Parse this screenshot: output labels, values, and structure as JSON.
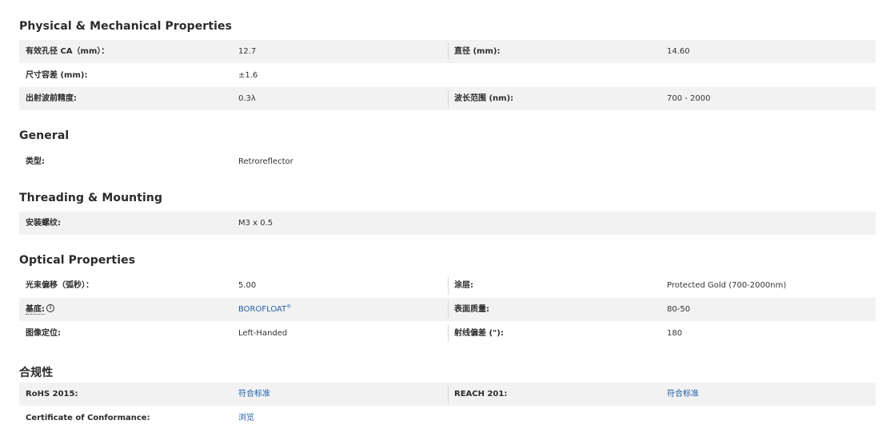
{
  "sections": {
    "physical": {
      "title": "Physical & Mechanical Properties",
      "rows": [
        {
          "l1": "有效孔径 CA（mm）：",
          "v1": "12.7",
          "l2": "直径 (mm):",
          "v2": "14.60"
        },
        {
          "l1": "尺寸容差 (mm):",
          "v1": "±1.6"
        },
        {
          "l1": "出射波前精度:",
          "v1": "0.3λ",
          "l2": "波长范围 (nm):",
          "v2": "700 - 2000"
        }
      ]
    },
    "general": {
      "title": "General",
      "rows": [
        {
          "l1": "类型:",
          "v1": "Retroreflector"
        }
      ]
    },
    "threading": {
      "title": "Threading & Mounting",
      "rows": [
        {
          "l1": "安装螺纹:",
          "v1": "M3 x 0.5"
        }
      ]
    },
    "optical": {
      "title": "Optical Properties",
      "rows": [
        {
          "l1": "光束偏移（弧秒）：",
          "v1": "5.00",
          "l2": "涂层:",
          "v2": "Protected Gold (700-2000nm)"
        },
        {
          "l1": "基底:",
          "v1": "BOROFLOAT",
          "v1_sup": "®",
          "l2": "表面质量:",
          "v2": "80-50"
        },
        {
          "l1": "图像定位:",
          "v1": "Left-Handed",
          "l2": "射线偏差 (\"):",
          "v2": "180"
        }
      ]
    },
    "compliance": {
      "title": "合规性",
      "rows": [
        {
          "l1": "RoHS 2015:",
          "v1": "符合标准",
          "l2": "REACH 201:",
          "v2": "符合标准"
        },
        {
          "l1": "Certificate of Conformance:",
          "v1": "浏览"
        }
      ]
    }
  },
  "icons": {
    "substrate_info": "info-circle-icon"
  },
  "colors": {
    "link": "#1f5fa8",
    "row_shade": "#f2f2f2",
    "heading": "#2b2b2b"
  }
}
